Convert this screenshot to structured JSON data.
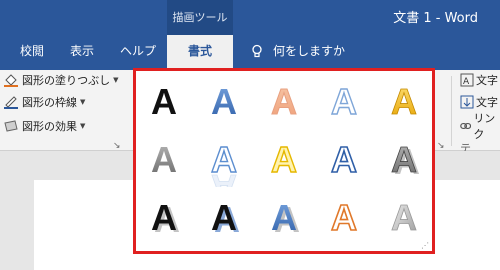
{
  "window": {
    "title": "文書 1  -  Word",
    "context_tab_group": "描画ツール"
  },
  "tabs": [
    {
      "label": "校閲"
    },
    {
      "label": "表示"
    },
    {
      "label": "ヘルプ"
    },
    {
      "label": "書式",
      "active": true
    }
  ],
  "tellme": {
    "label": "何をしますか"
  },
  "ribbon": {
    "fill_label": "図形の塗りつぶし",
    "outline_label": "図形の枠線",
    "effects_label": "図形の効果",
    "right_items": [
      "文字",
      "文字",
      "リンク"
    ],
    "right_group_label": "テ"
  },
  "wordart_gallery": {
    "letter": "A",
    "styles": [
      [
        "black-solid",
        "blue-gradient",
        "orange-pale-outline",
        "white-blue-outline",
        "gold-gradient"
      ],
      [
        "gray-gradient",
        "white-blue-reflection",
        "yellow-outline",
        "blue-white-outline",
        "gray-bevel"
      ],
      [
        "black-shadow",
        "black-blue-shadow",
        "blue-gradient-shadow",
        "orange-outline",
        "silver-bevel"
      ]
    ]
  },
  "colors": {
    "accent": "#2b579a",
    "highlight_border": "#e02020"
  }
}
